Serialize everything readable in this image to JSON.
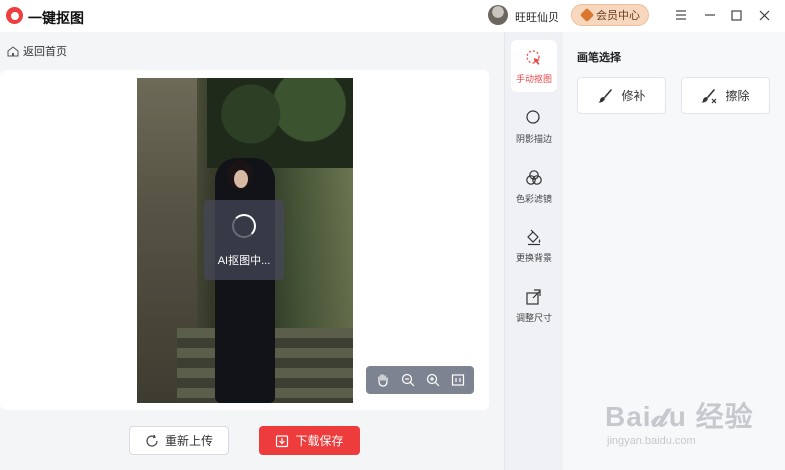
{
  "app": {
    "title": "一键抠图"
  },
  "header": {
    "username": "旺旺仙贝",
    "vip_label": "会员中心",
    "controls": [
      "menu-icon",
      "minimize-icon",
      "maximize-icon",
      "close-icon"
    ]
  },
  "main": {
    "back_label": "返回首页",
    "loading_text": "AI抠图中...",
    "zoom_tools": [
      "hand-icon",
      "zoom-out-icon",
      "zoom-in-icon",
      "fit-icon"
    ],
    "reupload_label": "重新上传",
    "download_label": "下载保存"
  },
  "tools": [
    {
      "label": "手动抠图",
      "icon": "cursor-click-icon",
      "active": true
    },
    {
      "label": "阴影描边",
      "icon": "shadow-circle-icon",
      "active": false
    },
    {
      "label": "色彩滤镜",
      "icon": "color-circles-icon",
      "active": false
    },
    {
      "label": "更换背景",
      "icon": "paint-bucket-icon",
      "active": false
    },
    {
      "label": "调整尺寸",
      "icon": "resize-icon",
      "active": false
    }
  ],
  "panel": {
    "title": "画笔选择",
    "repair_label": "修补",
    "erase_label": "擦除"
  },
  "watermark": {
    "main": "Bai𝓭u 经验",
    "sub": "jingyan.baidu.com"
  },
  "colors": {
    "accent": "#ee3b3b",
    "vip": "#f7d7bd"
  }
}
